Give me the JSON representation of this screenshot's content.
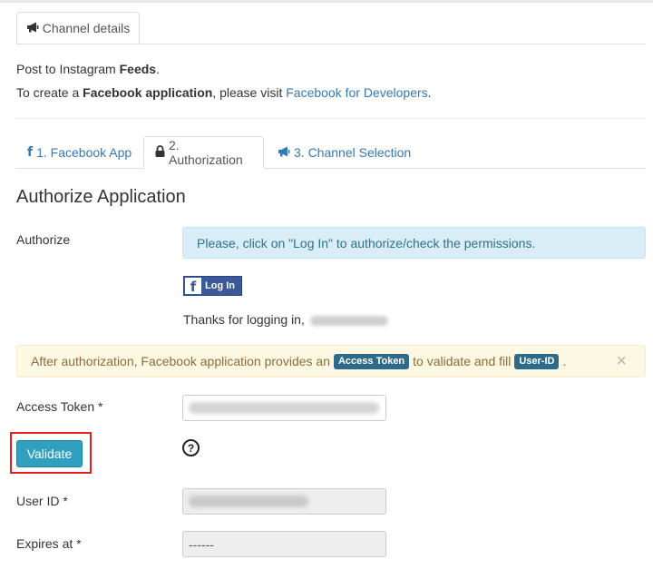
{
  "channel_tab": {
    "label": "Channel details",
    "icon": "megaphone-icon"
  },
  "intro": {
    "line1_prefix": "Post to Instagram ",
    "line1_bold": "Feeds",
    "line1_suffix": ".",
    "line2_prefix": "To create a ",
    "line2_bold": "Facebook application",
    "line2_mid": ", please visit ",
    "line2_link": "Facebook for Developers",
    "line2_suffix": "."
  },
  "steps": [
    {
      "label": "1. Facebook App",
      "icon": "facebook-f-icon"
    },
    {
      "label": "2. Authorization",
      "icon": "lock-icon",
      "active": true
    },
    {
      "label": "3. Channel Selection",
      "icon": "megaphone-icon"
    }
  ],
  "section_title": "Authorize Application",
  "authorize": {
    "label": "Authorize",
    "info": "Please, click on \"Log In\" to authorize/check the permissions.",
    "login_button": "Log In",
    "thanks_prefix": "Thanks for logging in, "
  },
  "alert": {
    "prefix": "After authorization, Facebook application provides an ",
    "badge1": "Access Token",
    "mid": " to validate and fill ",
    "badge2": "User-ID",
    "suffix": ".",
    "close": "×"
  },
  "fields": {
    "access_token_label": "Access Token *",
    "validate_button": "Validate",
    "help_icon": "?",
    "user_id_label": "User ID *",
    "expires_label": "Expires at *",
    "expires_value": "------"
  },
  "colors": {
    "link": "#337ab7",
    "info_bg": "#d9edf7",
    "warning_bg": "#fcf8e3",
    "validate_bg": "#31a0c0",
    "facebook_blue": "#3b5998",
    "highlight_red": "#e02020"
  }
}
